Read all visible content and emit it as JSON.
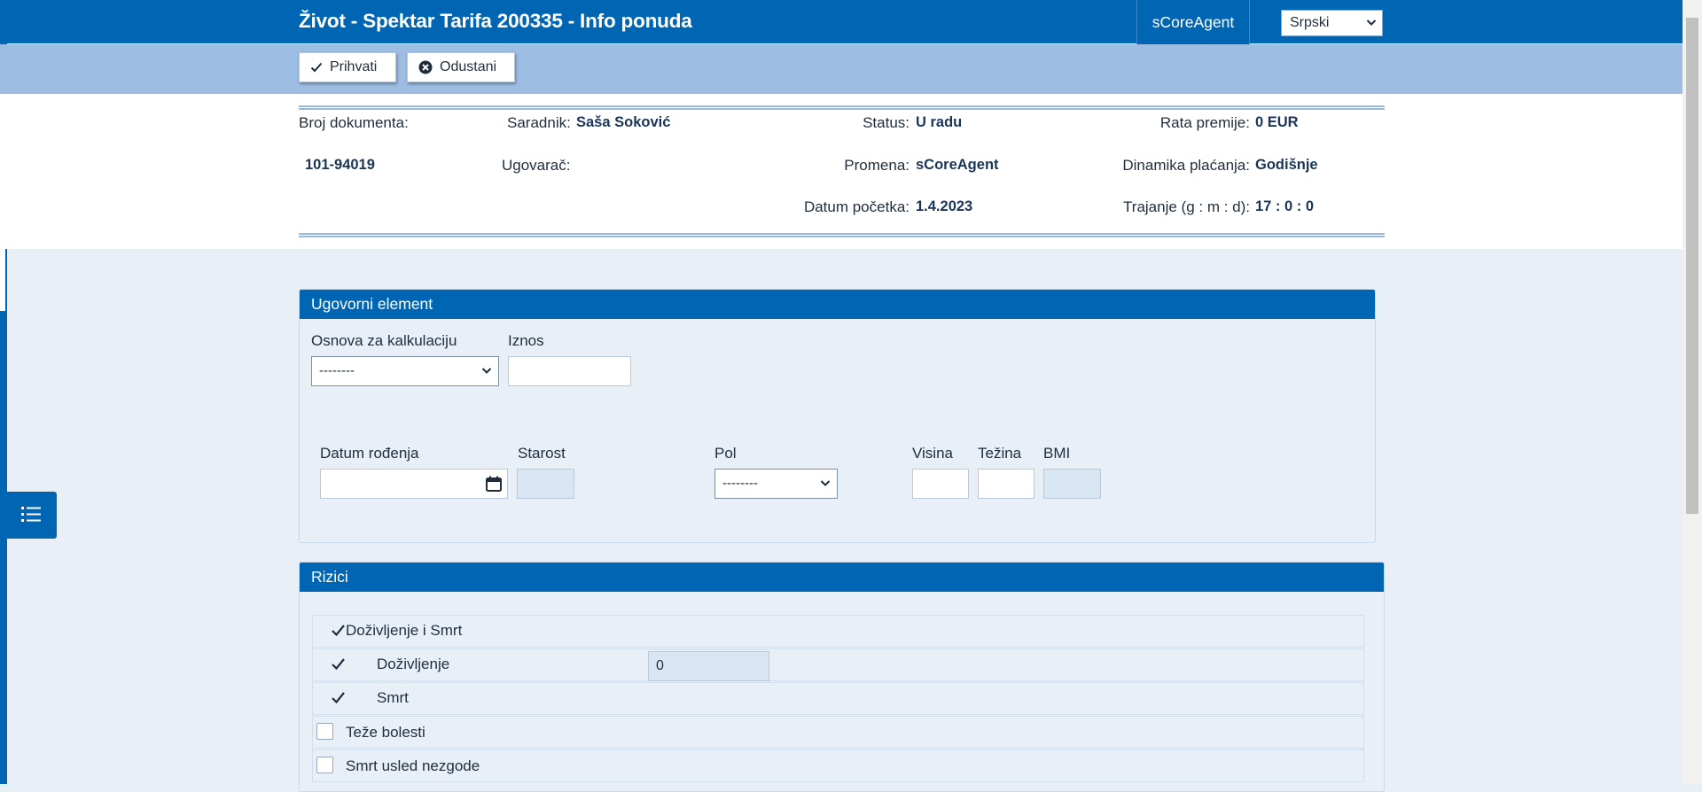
{
  "header": {
    "title": "Život - Spektar Tarifa 200335 - Info ponuda",
    "agent_tab": "sCoreAgent",
    "language": "Srpski",
    "brand_color": "#0066b3"
  },
  "toolbar": {
    "accept_label": "Prihvati",
    "cancel_label": "Odustani"
  },
  "info": {
    "doc_number_label": "Broj dokumenta:",
    "doc_number_value": "101-94019",
    "associate_label": "Saradnik:",
    "associate_value": "Saša Soković",
    "contractor_label": "Ugovarač:",
    "status_label": "Status:",
    "status_value": "U radu",
    "change_label": "Promena:",
    "change_value": "sCoreAgent",
    "start_date_label": "Datum početka:",
    "start_date_value": "1.4.2023",
    "premium_label": "Rata premije:",
    "premium_value": "0 EUR",
    "payment_label": "Dinamika plaćanja:",
    "payment_value": "Godišnje",
    "duration_label": "Trajanje (g : m : d):",
    "duration_value": "17 : 0 : 0"
  },
  "contract": {
    "title": "Ugovorni element",
    "calc_basis_label": "Osnova za kalkulaciju",
    "calc_basis_value": "--------",
    "amount_label": "Iznos",
    "amount_value": "",
    "birth_date_label": "Datum rođenja",
    "birth_date_value": "",
    "age_label": "Starost",
    "gender_label": "Pol",
    "gender_value": "--------",
    "height_label": "Visina",
    "weight_label": "Težina",
    "bmi_label": "BMI"
  },
  "risks": {
    "title": "Rizici",
    "items": [
      {
        "label": "Doživljenje i Smrt",
        "checked": true
      },
      {
        "label": "Doživljenje",
        "checked": true,
        "value": "0"
      },
      {
        "label": "Smrt",
        "checked": true
      },
      {
        "label": "Teže bolesti",
        "checked": false
      },
      {
        "label": "Smrt usled nezgode",
        "checked": false
      }
    ]
  },
  "icons": {
    "accept": "check-icon",
    "cancel": "close-circle-icon",
    "calendar": "calendar-icon",
    "side_menu": "list-icon"
  }
}
